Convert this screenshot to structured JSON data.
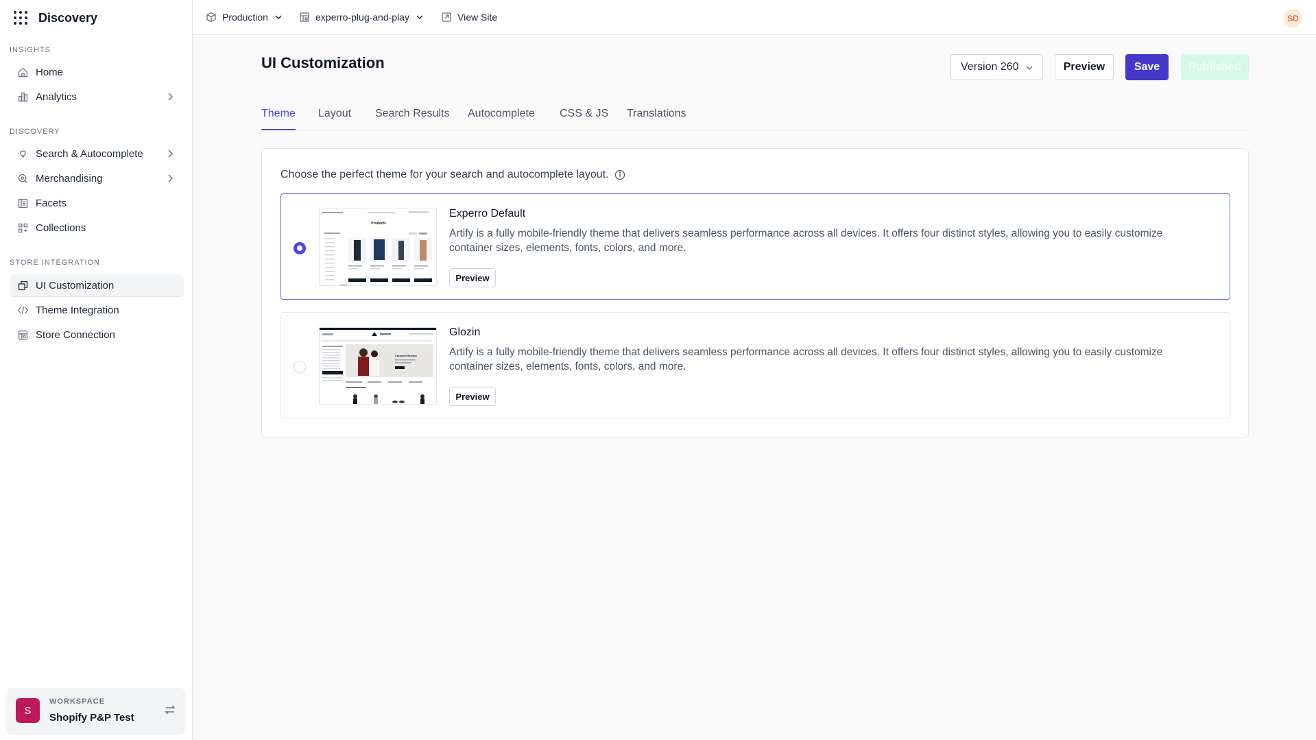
{
  "app": {
    "name": "Discovery"
  },
  "sidebar": {
    "sections": [
      {
        "label": "INSIGHTS"
      },
      {
        "label": "DISCOVERY"
      },
      {
        "label": "STORE INTEGRATION"
      }
    ],
    "items": [
      {
        "label": "Home",
        "icon": "home-icon"
      },
      {
        "label": "Analytics",
        "icon": "bar-chart-icon"
      },
      {
        "label": "Search & Autocomplete",
        "icon": "lightbulb-icon"
      },
      {
        "label": "Merchandising",
        "icon": "magnify-icon"
      },
      {
        "label": "Facets",
        "icon": "list-icon"
      },
      {
        "label": "Collections",
        "icon": "grid-icon"
      },
      {
        "label": "UI Customization",
        "icon": "copy-icon"
      },
      {
        "label": "Theme Integration",
        "icon": "code-icon"
      },
      {
        "label": "Store Connection",
        "icon": "store-icon"
      }
    ],
    "workspace": {
      "label": "WORKSPACE",
      "name": "Shopify P&P Test",
      "initial": "S"
    }
  },
  "topbar": {
    "environment": "Production",
    "site": "experro-plug-and-play",
    "view_site": "View Site",
    "user_initials": "SD"
  },
  "main": {
    "title": "UI Customization",
    "version": "Version 260",
    "preview_label": "Preview",
    "save_label": "Save",
    "published_label": "Published",
    "tabs": [
      {
        "label": "Theme"
      },
      {
        "label": "Layout"
      },
      {
        "label": "Search Results"
      },
      {
        "label": "Autocomplete"
      },
      {
        "label": "CSS & JS"
      },
      {
        "label": "Translations"
      }
    ],
    "description": "Choose the perfect theme for your search and autocomplete layout.",
    "themes": [
      {
        "name": "Experro Default",
        "description": "Artify is a fully mobile-friendly theme that delivers seamless performance across all devices. It offers four distinct styles, allowing you to easily customize container sizes, elements, fonts, colors, and more.",
        "preview_label": "Preview",
        "selected": true,
        "thumb_heading": "Products"
      },
      {
        "name": "Glozin",
        "description": "Artify is a fully mobile-friendly theme that delivers seamless performance across all devices. It offers four distinct styles, allowing you to easily customize container sizes, elements, fonts, colors, and more.",
        "preview_label": "Preview",
        "selected": false,
        "thumb_heading": "Carousel Builder"
      }
    ]
  },
  "colors": {
    "accent": "#4f46e5",
    "save": "#4338ca",
    "published": "#d1fae5",
    "workspace_avatar": "#be185d"
  }
}
